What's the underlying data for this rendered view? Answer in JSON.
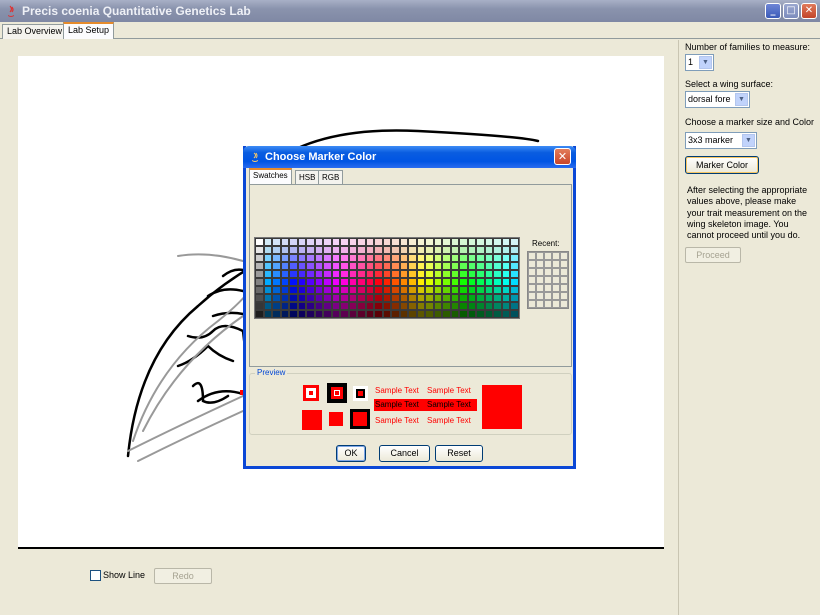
{
  "window": {
    "title": "Precis coenia Quantitative Genetics Lab",
    "minimize": "_",
    "maximize": "□",
    "close": "✕"
  },
  "tabs": [
    {
      "label": "Lab Overview"
    },
    {
      "label": "Lab Setup"
    }
  ],
  "bottom": {
    "show_line_label": "Show Line",
    "redo_label": "Redo"
  },
  "right_panel": {
    "families_label": "Number of families to measure:",
    "families_value": "1",
    "surface_label": "Select a wing surface:",
    "surface_value": "dorsal fore",
    "marker_label": "Choose a marker size and Color",
    "marker_size_value": "3x3 marker",
    "marker_color_button": "Marker Color",
    "instructions": "After selecting the appropriate values above, please make your trait measurement on the  wing skeleton image.  You cannot proceed until you do.",
    "proceed_label": "Proceed"
  },
  "dialog": {
    "title": "Choose Marker Color",
    "close": "✕",
    "tabs": [
      {
        "label": "Swatches"
      },
      {
        "label": "HSB"
      },
      {
        "label": "RGB"
      }
    ],
    "recent_label": "Recent:",
    "preview_label": "Preview",
    "sample_text": "Sample Text",
    "preview_color": "#ff0000",
    "ok_label": "OK",
    "cancel_label": "Cancel",
    "reset_label": "Reset"
  }
}
